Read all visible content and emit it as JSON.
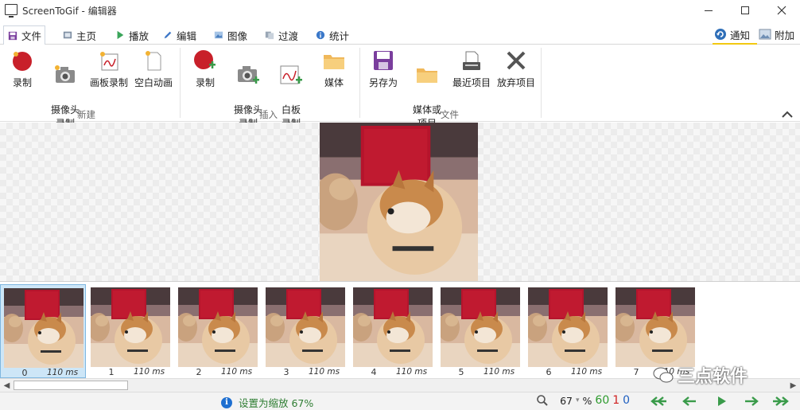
{
  "window": {
    "title": "ScreenToGif - 编辑器",
    "icon": "monitor-icon"
  },
  "tabs": [
    {
      "label": "文件",
      "icon": "save-icon",
      "active": true
    },
    {
      "label": "主页",
      "icon": "home-icon"
    },
    {
      "label": "播放",
      "icon": "play-icon"
    },
    {
      "label": "编辑",
      "icon": "pencil-icon"
    },
    {
      "label": "图像",
      "icon": "image-icon"
    },
    {
      "label": "过渡",
      "icon": "transition-icon"
    },
    {
      "label": "统计",
      "icon": "info-icon"
    }
  ],
  "right_tabs": {
    "notify_label": "通知",
    "extras_label": "附加"
  },
  "ribbon": {
    "groups": [
      {
        "label": "新建",
        "buttons": [
          {
            "label": "录制",
            "icon": "record-icon"
          },
          {
            "label": "摄像头\n录制",
            "icon": "camera-icon"
          },
          {
            "label": "画板录制",
            "icon": "board-icon"
          },
          {
            "label": "空白动画",
            "icon": "blank-file-icon"
          }
        ]
      },
      {
        "label": "插入",
        "buttons": [
          {
            "label": "录制",
            "icon": "record-add-icon"
          },
          {
            "label": "摄像头\n录制",
            "icon": "camera-add-icon"
          },
          {
            "label": "白板\n录制",
            "icon": "board-add-icon"
          },
          {
            "label": "媒体",
            "icon": "folder-icon"
          }
        ]
      },
      {
        "label": "文件",
        "buttons": [
          {
            "label": "另存为",
            "icon": "save-as-icon"
          },
          {
            "label": "媒体或\n项目",
            "icon": "folder-open-icon"
          },
          {
            "label": "最近项目",
            "icon": "recent-projects-icon"
          },
          {
            "label": "放弃项目",
            "icon": "discard-icon"
          }
        ]
      }
    ]
  },
  "frames": [
    {
      "index": "0",
      "duration": "110 ms",
      "selected": true
    },
    {
      "index": "1",
      "duration": "110 ms"
    },
    {
      "index": "2",
      "duration": "110 ms"
    },
    {
      "index": "3",
      "duration": "110 ms"
    },
    {
      "index": "4",
      "duration": "110 ms"
    },
    {
      "index": "5",
      "duration": "110 ms"
    },
    {
      "index": "6",
      "duration": "110 ms"
    },
    {
      "index": "7",
      "duration": "110 ms"
    }
  ],
  "watermark": {
    "text": "三点软件"
  },
  "status": {
    "message": "设置为缩放 67%",
    "zoom_value": "67",
    "zoom_unit": "%",
    "frame_count": "60",
    "selected_count": "1",
    "current_index": "0"
  },
  "colors": {
    "accent": "#1e6fd0",
    "status_green": "#2e7d32",
    "nav_green": "#3a9b4a",
    "record_red": "#c8202a"
  }
}
